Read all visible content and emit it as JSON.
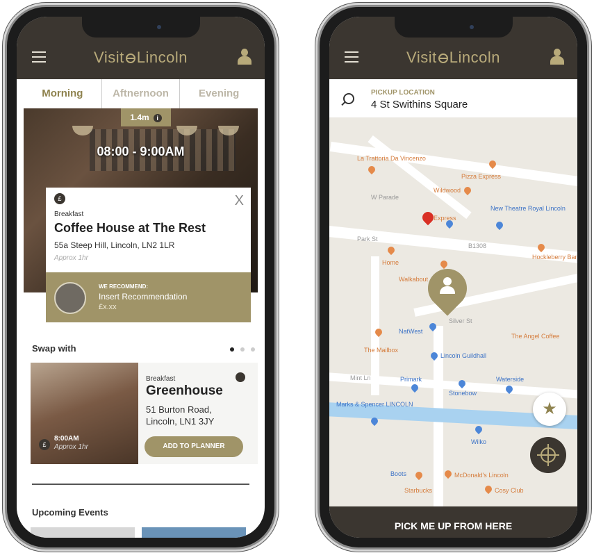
{
  "left_phone": {
    "header": {
      "logo_left": "Visit",
      "logo_right": "Lincoln"
    },
    "tabs": [
      {
        "label": "Morning"
      },
      {
        "label": "Aftnernoon"
      },
      {
        "label": "Evening"
      }
    ],
    "hero": {
      "distance": "1.4m",
      "info_glyph": "i",
      "time_range": "08:00 - 9:00AM"
    },
    "card": {
      "currency_glyph": "£",
      "close_glyph": "X",
      "category": "Breakfast",
      "title": "Coffee House at The Rest",
      "address": "55a Steep Hill, Lincoln, LN2 1LR",
      "duration": "Approx 1hr"
    },
    "recommend": {
      "heading": "WE RECOMMEND:",
      "text": "Insert Recommendation",
      "price": "£x.xx"
    },
    "swap": {
      "label": "Swap with",
      "carousel_active_index": 1,
      "carousel_count": 3,
      "card": {
        "time": "8:00AM",
        "duration": "Approx 1hr",
        "category": "Breakfast",
        "title": "Greenhouse",
        "address_line1": "51 Burton Road,",
        "address_line2": "Lincoln, LN1 3JY",
        "button": "ADD TO PLANNER"
      }
    },
    "events": {
      "label": "Upcoming Events"
    }
  },
  "right_phone": {
    "header": {
      "logo_left": "Visit",
      "logo_right": "Lincoln"
    },
    "search": {
      "label": "PICKUP LOCATION",
      "value": "4 St Swithins Square"
    },
    "map_labels": {
      "trattoria": "La Trattoria Da Vincenzo",
      "pizza": "Pizza Express",
      "wildwood": "Wildwood",
      "theatre": "New Theatre Royal Lincoln",
      "express": "Express",
      "home": "Home",
      "walkabout": "Walkabout",
      "hockley": "Hockleberry Bar and Grill",
      "natwest": "NatWest",
      "angel": "The Angel Coffee",
      "mailbox": "The Mailbox",
      "guildhall": "Lincoln Guildhall",
      "primark": "Primark",
      "stonebow": "Stonebow",
      "waterside": "Waterside",
      "ms": "Marks & Spencer LINCOLN",
      "wilko": "Wilko",
      "boots": "Boots",
      "starbucks": "Starbucks",
      "mcd": "McDonald's Lincoln",
      "cosy": "Cosy Club",
      "silver": "Silver St",
      "st": "B1308",
      "parade": "W Parade",
      "park": "Park St",
      "mint": "Mint Ln"
    },
    "cta": "PICK ME UP FROM HERE"
  }
}
